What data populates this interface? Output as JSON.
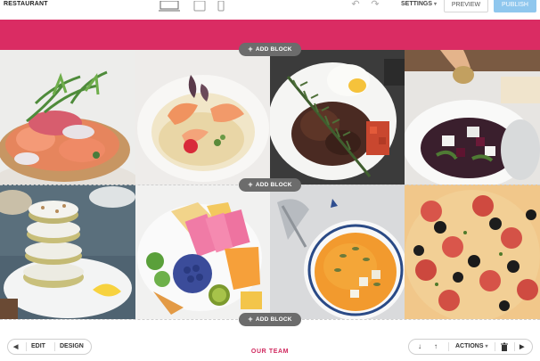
{
  "toolbar": {
    "site_name": "RESTAURANT",
    "device_icons": [
      "desktop-icon",
      "tablet-icon",
      "phone-icon"
    ],
    "undo_icon": "undo-icon",
    "redo_icon": "redo-icon",
    "settings_label": "SETTINGS",
    "preview_label": "PREVIEW",
    "publish_label": "PUBLISH"
  },
  "colors": {
    "accent_pink": "#da2c63",
    "publish_blue": "#8fc7ee",
    "pill_gray": "#6c6c6c"
  },
  "add_block_label": "ADD BLOCK",
  "gallery": {
    "tiles": [
      "smoked-salmon-toast",
      "shrimp-cream-dish",
      "steak-with-rosemary",
      "beet-feta-salad",
      "stacked-frosted-donuts",
      "fruit-platter",
      "pumpkin-soup",
      "pepperoni-pizza"
    ]
  },
  "section_title": "OUR TEAM",
  "edit_controls": {
    "edit_label": "EDIT",
    "design_label": "DESIGN"
  },
  "block_actions": {
    "actions_label": "ACTIONS"
  }
}
